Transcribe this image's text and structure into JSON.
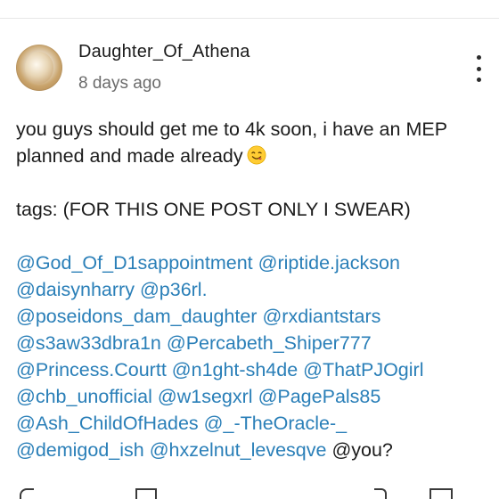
{
  "post": {
    "username": "Daughter_Of_Athena",
    "timestamp": "8 days ago",
    "more_icon": "vertical-ellipsis-icon",
    "avatar_icon": "profile-avatar",
    "text_line1": "you guys should get me to 4k soon, i have an MEP",
    "text_line2": "planned and made already",
    "emoji": "face-savoring-food-emoji",
    "tags_line": "tags: (FOR THIS ONE POST ONLY I SWEAR)",
    "mentions": [
      "@God_Of_D1sappointment",
      "@riptide.jackson",
      "@daisynharry",
      "@p36rl.",
      "@poseidons_dam_daughter",
      "@rxdiantstars",
      "@s3aw33dbra1n",
      "@Percabeth_Shiper777",
      "@Princess.Courtt",
      "@n1ght-sh4de",
      "@ThatPJOgirl",
      "@chb_unofficial",
      "@w1segxrl",
      "@PagePals85",
      "@Ash_ChildOfHades",
      "@_-TheOracle-_",
      "@demigod_ish",
      "@hxzelnut_levesqve"
    ],
    "trailing_text": "@you?"
  },
  "colors": {
    "mention": "#2a7fb8",
    "text": "#1c1c1c",
    "muted": "#6b6b6b"
  }
}
